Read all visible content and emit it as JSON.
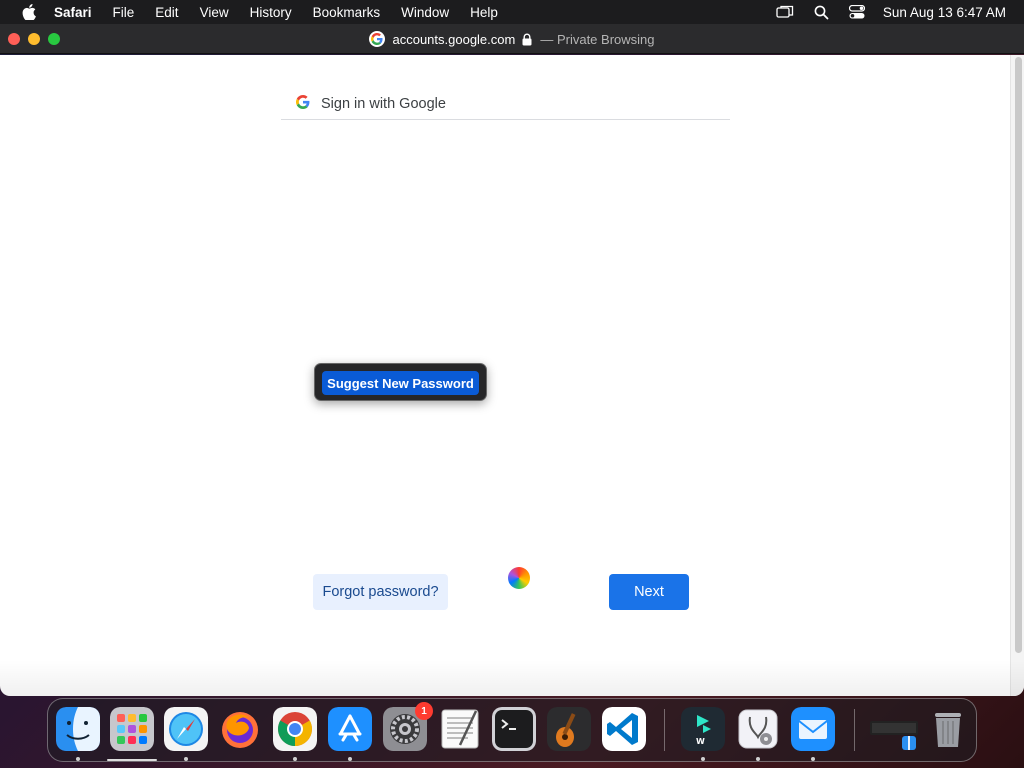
{
  "menubar": {
    "app_name": "Safari",
    "items": [
      "File",
      "Edit",
      "View",
      "History",
      "Bookmarks",
      "Window",
      "Help"
    ],
    "clock": "Sun Aug 13  6:47 AM"
  },
  "window": {
    "domain": "accounts.google.com",
    "private_label": "— Private Browsing"
  },
  "page": {
    "header_label": "Sign in with Google",
    "suggest_password_label": "Suggest New Password",
    "forgot_password_label": "Forgot password?",
    "next_label": "Next"
  },
  "dock": {
    "apps": [
      {
        "name": "Finder",
        "icon": "finder-icon"
      },
      {
        "name": "Launchpad",
        "icon": "launchpad-icon"
      },
      {
        "name": "Safari",
        "icon": "safari-icon"
      },
      {
        "name": "Firefox",
        "icon": "firefox-icon"
      },
      {
        "name": "Chrome",
        "icon": "chrome-icon"
      },
      {
        "name": "App Store",
        "icon": "app-store-icon"
      },
      {
        "name": "System Settings",
        "icon": "system-settings-icon"
      },
      {
        "name": "TextEdit",
        "icon": "textedit-icon"
      },
      {
        "name": "Terminal",
        "icon": "terminal-icon"
      },
      {
        "name": "GarageBand",
        "icon": "garageband-icon"
      },
      {
        "name": "VS Code",
        "icon": "vscode-icon"
      },
      {
        "name": "Filmora",
        "icon": "filmora-icon"
      },
      {
        "name": "Disk Utility",
        "icon": "disk-utility-icon"
      },
      {
        "name": "Mail",
        "icon": "mail-icon"
      }
    ],
    "settings_badge": "1"
  },
  "colors": {
    "accent_blue": "#1a73e8",
    "suggest_blue": "#0a5bd6",
    "forgot_bg": "#e8f0fe"
  }
}
